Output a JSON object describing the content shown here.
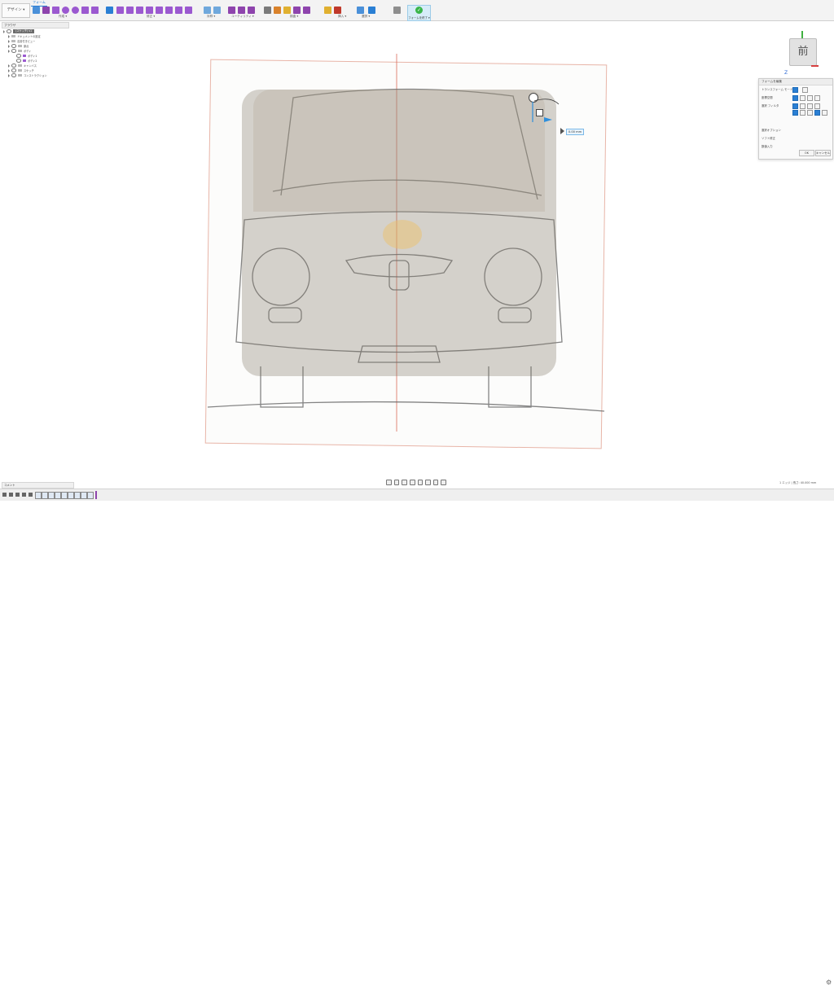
{
  "toolbar": {
    "workspace": "デザイン ▾",
    "active_tab": "フォーム",
    "groups": [
      "作成 ▾",
      "修正 ▾",
      "対称 ▾",
      "ユーティリティ ▾",
      "検査 ▾",
      "挿入 ▾",
      "選択 ▾",
      "フォームを終了 ▾"
    ],
    "finish_label": "フォームを終了 ▾"
  },
  "browser": {
    "title": "ブラウザ",
    "items": [
      "(スケッチ) v1",
      "ドキュメントの設定",
      "名前付きビュー",
      "原点",
      "ボディ",
      "ボディ1",
      "ボディ2",
      "キャンバス",
      "スケッチ",
      "コンストラクション"
    ]
  },
  "viewcube": {
    "face": "前",
    "z_axis": "Z"
  },
  "dim_input": {
    "value": "0.00 mm"
  },
  "panel": {
    "title": "フォームを編集",
    "rows": [
      "トランスフォーム モード",
      "座標空間",
      "選択 フィルタ",
      "選択オプション",
      "ソフト修正",
      "数値入力"
    ],
    "ok": "OK",
    "cancel": "キャンセル"
  },
  "comments": {
    "label": "コメント"
  },
  "status": {
    "text": "1 エッジ | 長さ: 40.000 mm"
  },
  "colors": {
    "accent": "#2a7fd4",
    "tsurf_body": "#9b59d0",
    "finish": "#39b54a"
  }
}
